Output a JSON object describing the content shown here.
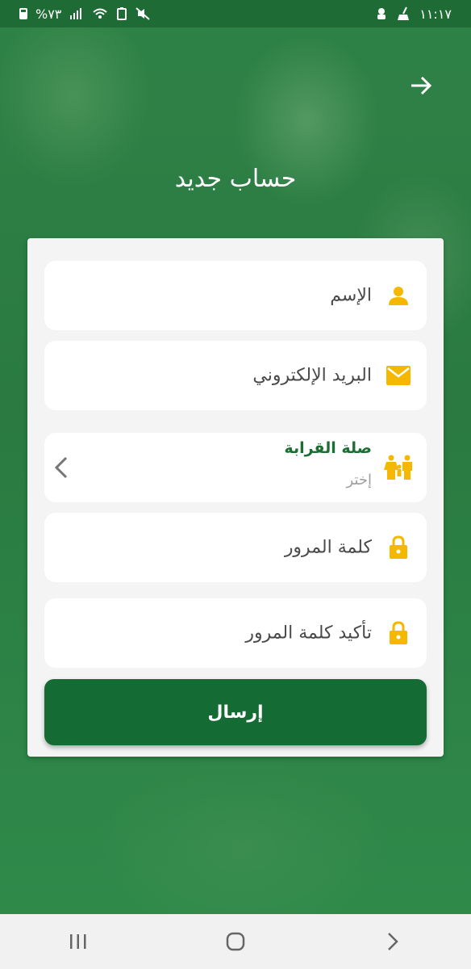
{
  "status_bar": {
    "time": "١١:١٧",
    "battery": "%٧٣",
    "icons": [
      "battery-icon",
      "signal-icon",
      "wifi-icon",
      "battery-saver-icon",
      "mute-icon",
      "android-icon",
      "cleaner-icon"
    ]
  },
  "header": {
    "title": "حساب جديد",
    "nav_icon": "arrow-right-icon"
  },
  "form": {
    "name_label": "الإسم",
    "email_label": "البريد الإلكتروني",
    "relation": {
      "title": "صلة القرابة",
      "value": "إختر"
    },
    "password_label": "كلمة المرور",
    "confirm_password_label": "تأكيد كلمة المرور",
    "submit_label": "إرسال"
  },
  "colors": {
    "accent": "#146b33",
    "icon": "#f5b800",
    "relation_title": "#1d6e34"
  },
  "system_nav": [
    "recents-icon",
    "home-icon",
    "back-icon"
  ]
}
